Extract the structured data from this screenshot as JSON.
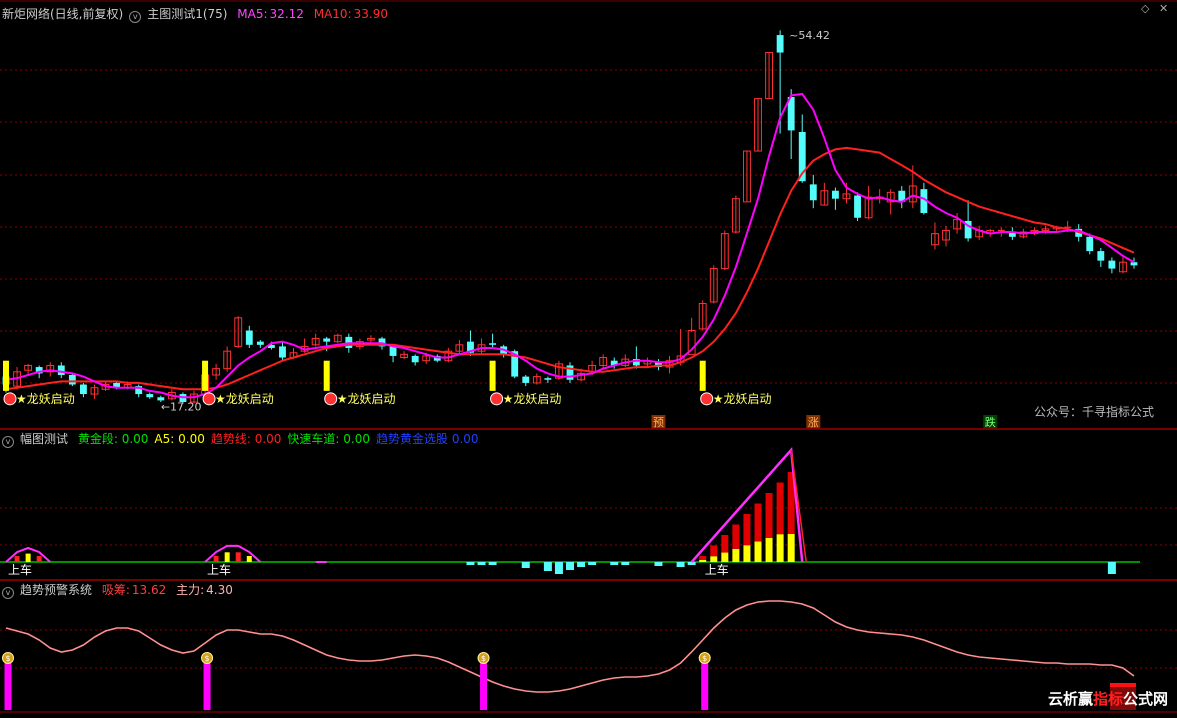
{
  "panel1": {
    "stock": "新炬网络(日线,前复权)",
    "indicator": "主图测试1(75)",
    "ma5_label": "MA5:",
    "ma5_value": "32.12",
    "ma10_label": "MA10:",
    "ma10_value": "33.90"
  },
  "panel2": {
    "name": "幅图测试",
    "items": [
      {
        "label": "黄金段:",
        "value": "0.00",
        "color": "#00e000"
      },
      {
        "label": "A5:",
        "value": "0.00",
        "color": "#ffff00"
      },
      {
        "label": "趋势线:",
        "value": "0.00",
        "color": "#ff2020"
      },
      {
        "label": "快速车道:",
        "value": "0.00",
        "color": "#00e000"
      },
      {
        "label": "趋势黄金选股",
        "value": "0.00",
        "color": "#2040ff"
      }
    ]
  },
  "panel3": {
    "name": "趋势预警系统",
    "xichou_label": "吸筹:",
    "xichou_value": "13.62",
    "zhuli_label": "主力:",
    "zhuli_value": "4.30"
  },
  "watermark": "公众号：千寻指标公式",
  "logo": {
    "a": "云析赢",
    "b": "指标",
    "c": "公式网"
  },
  "colors": {
    "up": "#ff3232",
    "down": "#54fcfc",
    "ma5": "#ff00ff",
    "ma10": "#ff2020",
    "grid": "#8b0000"
  },
  "chart_data": [
    {
      "type": "candlestick",
      "candles": [
        [
          32.6,
          32.1,
          33.0,
          31.6
        ],
        [
          32.0,
          32.9,
          33.2,
          31.8
        ],
        [
          33.0,
          33.3,
          33.4,
          32.7
        ],
        [
          33.2,
          32.8,
          33.3,
          32.5
        ],
        [
          32.9,
          33.3,
          33.5,
          32.6
        ],
        [
          33.3,
          32.7,
          33.5,
          32.5
        ],
        [
          32.7,
          32.1,
          32.8,
          32.0
        ],
        [
          32.1,
          31.5,
          32.2,
          31.3
        ],
        [
          31.5,
          31.9,
          32.1,
          31.2
        ],
        [
          31.8,
          32.1,
          32.3,
          31.7
        ],
        [
          32.2,
          31.9,
          32.3,
          31.8
        ],
        [
          31.9,
          32.1,
          32.3,
          31.8
        ],
        [
          32.0,
          31.5,
          32.1,
          31.3
        ],
        [
          31.5,
          31.3,
          31.6,
          31.2
        ],
        [
          31.3,
          31.1,
          31.4,
          31.0
        ],
        [
          31.2,
          31.6,
          31.8,
          31.1
        ],
        [
          31.5,
          31.0,
          31.6,
          30.9
        ],
        [
          31.0,
          31.5,
          31.7,
          30.9
        ],
        [
          31.5,
          32.7,
          32.9,
          31.4
        ],
        [
          32.7,
          33.1,
          33.4,
          32.4
        ],
        [
          33.1,
          34.2,
          34.5,
          32.9
        ],
        [
          34.5,
          36.3,
          36.4,
          34.4
        ],
        [
          35.5,
          34.6,
          35.8,
          34.4
        ],
        [
          34.8,
          34.6,
          34.9,
          34.4
        ],
        [
          34.6,
          34.4,
          34.8,
          34.3
        ],
        [
          34.5,
          33.8,
          34.8,
          33.6
        ],
        [
          33.8,
          34.1,
          34.4,
          33.7
        ],
        [
          34.2,
          34.5,
          35.0,
          34.1
        ],
        [
          34.6,
          35.0,
          35.3,
          34.5
        ],
        [
          35.0,
          34.8,
          35.1,
          34.2
        ],
        [
          34.8,
          35.2,
          35.3,
          34.7
        ],
        [
          35.1,
          34.4,
          35.3,
          34.1
        ],
        [
          34.5,
          34.8,
          35.0,
          34.3
        ],
        [
          34.9,
          35.0,
          35.2,
          34.7
        ],
        [
          35.0,
          34.5,
          35.1,
          34.3
        ],
        [
          34.5,
          33.9,
          34.6,
          33.5
        ],
        [
          33.8,
          34.0,
          34.2,
          33.7
        ],
        [
          33.9,
          33.5,
          34.0,
          33.3
        ],
        [
          33.6,
          33.9,
          34.1,
          33.4
        ],
        [
          33.9,
          33.6,
          34.0,
          33.5
        ],
        [
          33.6,
          34.2,
          34.4,
          33.5
        ],
        [
          34.2,
          34.6,
          34.9,
          34.0
        ],
        [
          34.8,
          34.1,
          35.5,
          33.9
        ],
        [
          34.2,
          34.6,
          35.0,
          34.0
        ],
        [
          34.7,
          34.6,
          35.3,
          34.4
        ],
        [
          34.5,
          34.0,
          34.6,
          33.8
        ],
        [
          34.2,
          32.6,
          34.3,
          32.5
        ],
        [
          32.6,
          32.2,
          32.7,
          32.0
        ],
        [
          32.2,
          32.6,
          32.8,
          32.1
        ],
        [
          32.5,
          32.4,
          32.6,
          32.2
        ],
        [
          32.5,
          33.4,
          33.6,
          32.4
        ],
        [
          33.3,
          32.4,
          33.5,
          32.2
        ],
        [
          32.4,
          32.8,
          33.1,
          32.3
        ],
        [
          32.9,
          33.3,
          33.6,
          32.7
        ],
        [
          33.3,
          33.8,
          34.0,
          33.1
        ],
        [
          33.6,
          33.3,
          33.8,
          33.1
        ],
        [
          33.3,
          33.7,
          34.0,
          33.2
        ],
        [
          33.7,
          33.3,
          34.5,
          33.1
        ],
        [
          33.4,
          33.6,
          33.8,
          33.2
        ],
        [
          33.5,
          33.2,
          33.7,
          33.0
        ],
        [
          33.2,
          33.6,
          33.9,
          32.8
        ],
        [
          33.5,
          33.9,
          35.6,
          33.3
        ],
        [
          34.0,
          35.5,
          36.3,
          35.4
        ],
        [
          35.6,
          37.2,
          37.4,
          35.5
        ],
        [
          37.3,
          39.4,
          39.6,
          37.2
        ],
        [
          39.4,
          41.6,
          41.8,
          39.3
        ],
        [
          41.7,
          43.8,
          44.0,
          41.6
        ],
        [
          43.6,
          46.8,
          46.8,
          43.6
        ],
        [
          46.8,
          50.1,
          50.1,
          46.8
        ],
        [
          50.1,
          53.0,
          53.0,
          50.1
        ],
        [
          54.1,
          53.0,
          54.4,
          47.9
        ],
        [
          50.2,
          48.1,
          50.7,
          46.3
        ],
        [
          48.0,
          44.9,
          49.1,
          44.8
        ],
        [
          44.7,
          43.7,
          45.3,
          43.2
        ],
        [
          43.4,
          44.3,
          44.8,
          43.4
        ],
        [
          44.3,
          43.8,
          44.5,
          43.1
        ],
        [
          43.8,
          44.1,
          44.8,
          43.5
        ],
        [
          44.0,
          42.6,
          44.2,
          42.4
        ],
        [
          42.6,
          43.9,
          44.6,
          42.5
        ],
        [
          43.8,
          43.9,
          44.4,
          43.5
        ],
        [
          43.6,
          44.2,
          44.4,
          42.8
        ],
        [
          44.3,
          43.6,
          44.6,
          43.2
        ],
        [
          43.6,
          44.6,
          45.9,
          43.2
        ],
        [
          44.4,
          42.9,
          44.8,
          42.8
        ],
        [
          40.9,
          41.6,
          42.3,
          40.6
        ],
        [
          41.2,
          41.8,
          42.1,
          40.8
        ],
        [
          41.9,
          42.5,
          42.9,
          41.6
        ],
        [
          42.4,
          41.3,
          43.7,
          41.1
        ],
        [
          41.4,
          41.8,
          42.1,
          41.2
        ],
        [
          41.6,
          41.8,
          41.9,
          41.4
        ],
        [
          41.8,
          41.8,
          42.0,
          41.4
        ],
        [
          41.7,
          41.4,
          42.0,
          41.2
        ],
        [
          41.4,
          41.7,
          41.9,
          41.3
        ],
        [
          41.6,
          41.8,
          42.0,
          41.5
        ],
        [
          41.8,
          41.9,
          42.1,
          41.6
        ],
        [
          41.9,
          42.0,
          42.1,
          41.7
        ],
        [
          42.0,
          42.0,
          42.4,
          41.7
        ],
        [
          41.9,
          41.4,
          42.2,
          41.1
        ],
        [
          41.4,
          40.5,
          41.6,
          40.3
        ],
        [
          40.5,
          39.9,
          40.7,
          39.5
        ],
        [
          39.9,
          39.4,
          40.1,
          39.1
        ],
        [
          39.2,
          39.8,
          40.1,
          39.1
        ],
        [
          39.8,
          39.6,
          40.1,
          39.4
        ]
      ],
      "ma5": [
        32.4,
        32.5,
        32.7,
        32.9,
        33.0,
        32.9,
        32.8,
        32.6,
        32.3,
        32.0,
        31.9,
        31.9,
        31.9,
        31.7,
        31.6,
        31.4,
        31.3,
        31.3,
        31.5,
        31.9,
        32.6,
        33.3,
        33.8,
        34.2,
        34.7,
        34.8,
        34.6,
        34.3,
        34.4,
        34.5,
        34.6,
        34.7,
        34.7,
        34.7,
        34.7,
        34.5,
        34.4,
        34.2,
        34.0,
        33.8,
        33.8,
        34.0,
        34.2,
        34.4,
        34.4,
        34.3,
        34.0,
        33.6,
        33.1,
        32.8,
        32.6,
        32.6,
        32.7,
        32.8,
        33.1,
        33.3,
        33.5,
        33.6,
        33.6,
        33.5,
        33.5,
        33.7,
        34.3,
        35.1,
        36.2,
        37.7,
        39.5,
        41.6,
        43.8,
        46.5,
        48.9,
        50.3,
        50.4,
        49.4,
        47.6,
        45.6,
        44.5,
        44.1,
        43.8,
        43.9,
        43.7,
        43.6,
        44.0,
        43.8,
        43.3,
        42.9,
        42.6,
        42.1,
        41.8,
        41.6,
        41.7,
        41.7,
        41.6,
        41.7,
        41.7,
        41.7,
        41.8,
        41.8,
        41.5,
        41.2,
        40.7,
        40.2,
        39.8
      ],
      "ma10": [
        31.8,
        31.9,
        32.0,
        32.1,
        32.2,
        32.3,
        32.3,
        32.3,
        32.3,
        32.3,
        32.3,
        32.2,
        32.2,
        32.1,
        32.0,
        31.9,
        31.8,
        31.8,
        31.8,
        31.9,
        32.1,
        32.4,
        32.7,
        33.0,
        33.3,
        33.6,
        33.8,
        34.0,
        34.2,
        34.4,
        34.5,
        34.6,
        34.6,
        34.6,
        34.6,
        34.6,
        34.5,
        34.4,
        34.3,
        34.2,
        34.1,
        34.0,
        34.0,
        34.0,
        34.0,
        34.0,
        33.9,
        33.8,
        33.6,
        33.4,
        33.2,
        33.1,
        33.0,
        32.9,
        32.9,
        33.0,
        33.1,
        33.2,
        33.2,
        33.3,
        33.3,
        33.5,
        33.8,
        34.2,
        34.8,
        35.6,
        36.6,
        37.9,
        39.4,
        41.1,
        42.8,
        44.3,
        45.4,
        46.2,
        46.6,
        46.9,
        47.0,
        46.9,
        46.8,
        46.7,
        46.3,
        45.9,
        45.5,
        45.0,
        44.6,
        44.2,
        43.9,
        43.6,
        43.3,
        43.1,
        42.9,
        42.7,
        42.5,
        42.3,
        42.2,
        42.0,
        41.9,
        41.7,
        41.5,
        41.3,
        41.0,
        40.7,
        40.4
      ],
      "high_label": "54.42",
      "low_label": "←17.20",
      "annotation": "★龙妖启动",
      "signal_bars": [
        0,
        18,
        29,
        44,
        63
      ],
      "markers": [
        {
          "i": 59,
          "text": "预"
        },
        {
          "i": 73,
          "text": "涨"
        },
        {
          "i": 89,
          "text": "跌"
        }
      ]
    },
    {
      "type": "bar",
      "label": "上车",
      "label_bars": [
        0,
        18,
        63
      ]
    },
    {
      "type": "line",
      "signal_bars": [
        0,
        18,
        43,
        63,
        109
      ]
    }
  ]
}
